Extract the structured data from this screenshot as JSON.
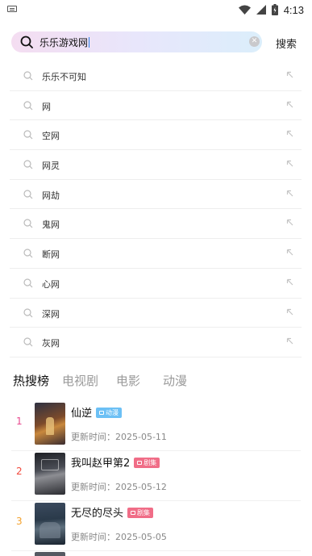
{
  "status": {
    "time": "4:13"
  },
  "search": {
    "query": "乐乐游戏网",
    "action_label": "搜索"
  },
  "suggestions": [
    "乐乐不可知",
    "网",
    "空网",
    "网灵",
    "网劫",
    "鬼网",
    "断网",
    "心网",
    "深网",
    "灰网"
  ],
  "tabs": [
    "热搜榜",
    "电视剧",
    "电影",
    "动漫"
  ],
  "date_prefix": "更新时间：",
  "ranking": [
    {
      "rank": "1",
      "title": "仙逆",
      "badge": "动漫",
      "badge_color": "#6cc0f5",
      "rank_color": "#e84a8f",
      "date": "2025-05-11"
    },
    {
      "rank": "2",
      "title": "我叫赵甲第2",
      "badge": "剧集",
      "badge_color": "#f06d87",
      "rank_color": "#f24a3d",
      "date": "2025-05-12"
    },
    {
      "rank": "3",
      "title": "无尽的尽头",
      "badge": "剧集",
      "badge_color": "#f06d87",
      "rank_color": "#f3a12d",
      "date": "2025-05-05"
    }
  ],
  "icons": {
    "status": [
      "wifi-icon",
      "signal-icon",
      "battery-icon"
    ],
    "search": "search-icon",
    "suggestion": "search-icon",
    "suggestion_action": "arrow-up-left-icon"
  }
}
